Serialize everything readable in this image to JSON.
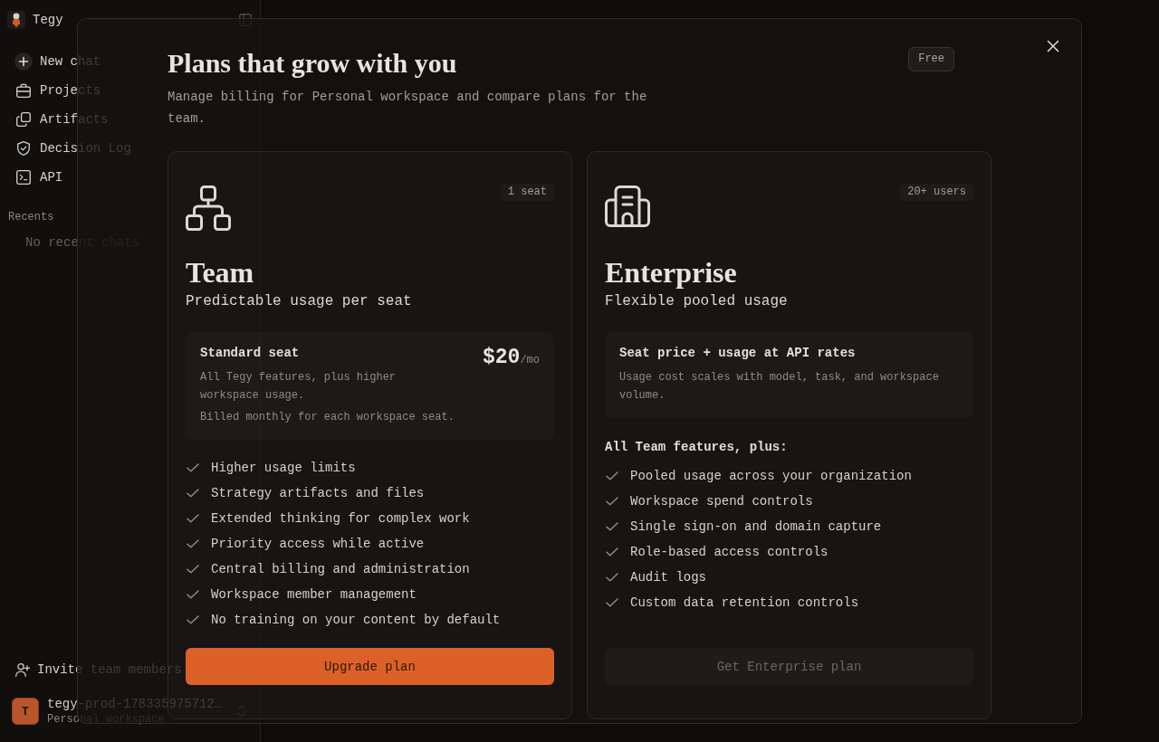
{
  "sidebar": {
    "brand": "Tegy",
    "nav": [
      {
        "label": "New chat"
      },
      {
        "label": "Projects"
      },
      {
        "label": "Artifacts"
      },
      {
        "label": "Decision Log"
      },
      {
        "label": "API"
      }
    ],
    "recents_heading": "Recents",
    "recents_empty": "No recent chats",
    "invite": "Invite team members",
    "account": {
      "initial": "T",
      "name": "tegy-prod-178335975712…",
      "workspace": "Personal workspace"
    }
  },
  "dialog": {
    "title": "Plans that grow with you",
    "description": "Manage billing for Personal workspace and compare plans for the team.",
    "current_plan_badge": "Free",
    "plans": [
      {
        "name": "Team",
        "tagline": "Predictable usage per seat",
        "badge": "1 seat",
        "pricing": {
          "title": "Standard seat",
          "description": "All Tegy features, plus higher workspace usage.",
          "price": "$20",
          "period": "/mo",
          "billing": "Billed monthly for each workspace seat."
        },
        "features": [
          "Higher usage limits",
          "Strategy artifacts and files",
          "Extended thinking for complex work",
          "Priority access while active",
          "Central billing and administration",
          "Workspace member management",
          "No training on your content by default"
        ],
        "button": {
          "label": "Upgrade plan",
          "disabled": false
        }
      },
      {
        "name": "Enterprise",
        "tagline": "Flexible pooled usage",
        "badge": "20+ users",
        "pricing": {
          "title": "Seat price + usage at API rates",
          "description": "Usage cost scales with model, task, and workspace volume."
        },
        "features_heading": "All Team features, plus:",
        "features": [
          "Pooled usage across your organization",
          "Workspace spend controls",
          "Single sign-on and domain capture",
          "Role-based access controls",
          "Audit logs",
          "Custom data retention controls"
        ],
        "button": {
          "label": "Get Enterprise plan",
          "disabled": true
        }
      }
    ]
  }
}
